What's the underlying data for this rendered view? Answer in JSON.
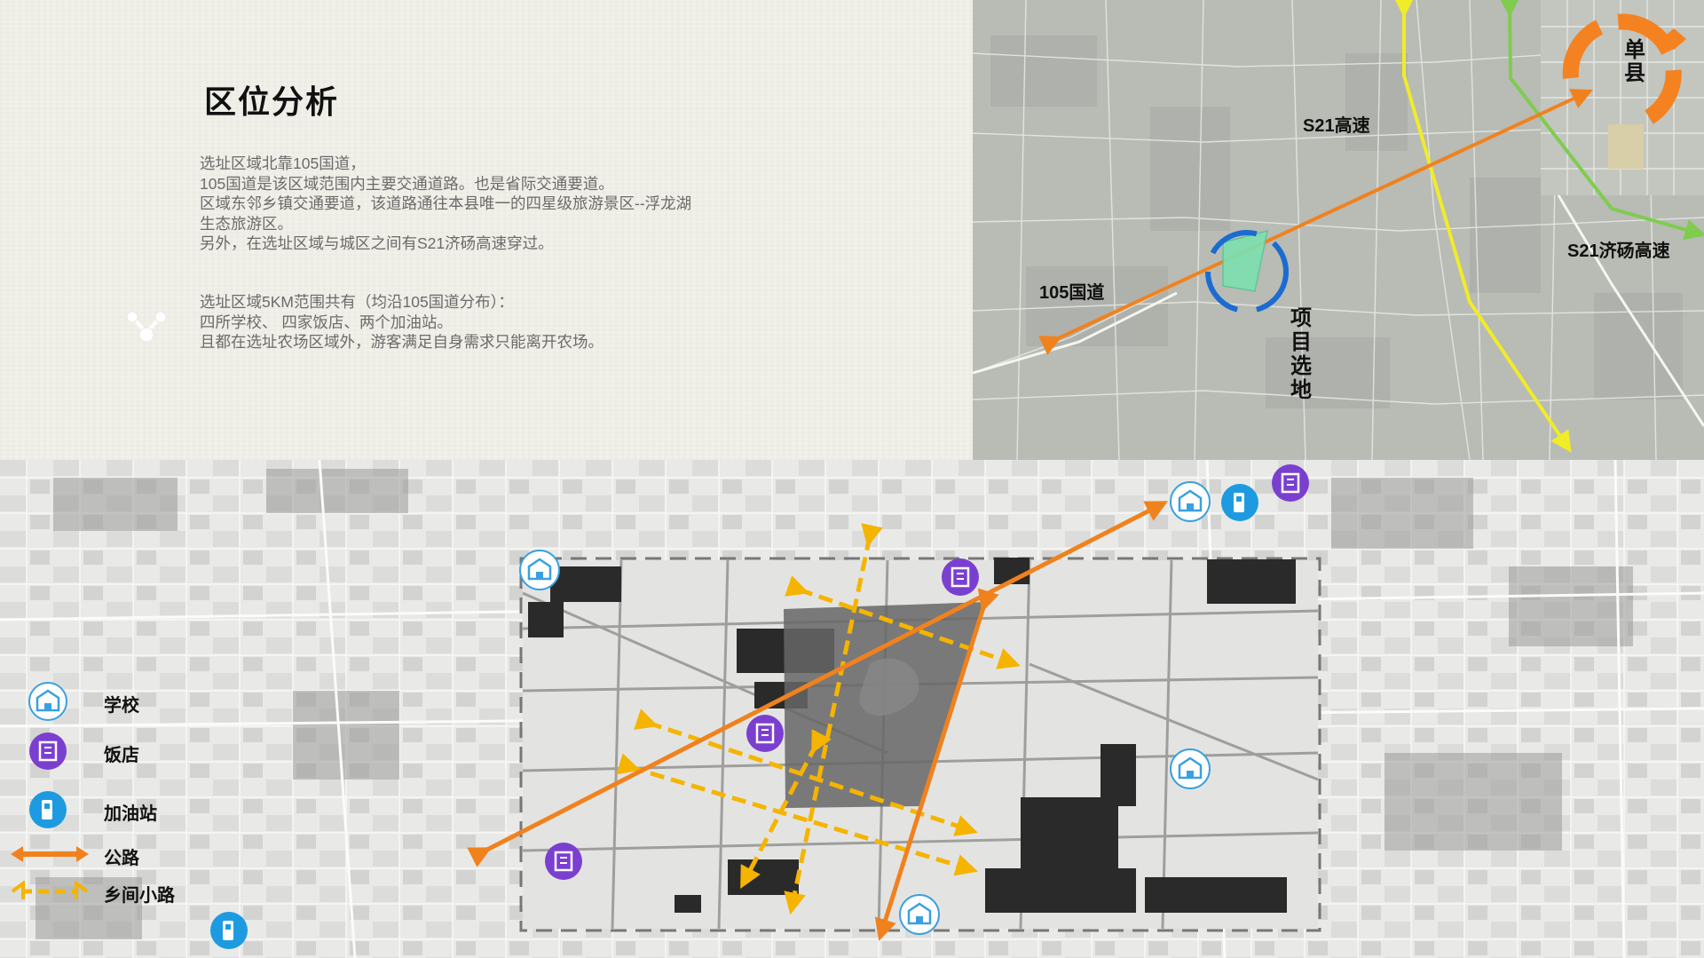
{
  "header": {
    "title": "区位分析"
  },
  "description": {
    "paragraph1": [
      "选址区域北靠105国道，",
      "105国道是该区域范围内主要交通道路。也是省际交通要道。",
      "区域东邻乡镇交通要道，该道路通往本县唯一的四星级旅游景区--浮龙湖",
      "生态旅游区。",
      "另外，在选址区域与城区之间有S21济砀高速穿过。"
    ],
    "paragraph2": [
      "选址区域5KM范围共有（均沿105国道分布）：",
      "四所学校、 四家饭店、两个加油站。",
      "且都在选址农场区域外，游客满足自身需求只能离开农场。"
    ]
  },
  "top_map": {
    "labels": {
      "s21_highway": "S21高速",
      "s21_jidang": "S21济砀高速",
      "road_105": "105国道",
      "county_char1": "单",
      "county_char2": "县",
      "site_chars": [
        "项",
        "目",
        "选",
        "地"
      ]
    },
    "colors": {
      "national_road": "#f0821e",
      "s21": "#f0ec28",
      "s21_jidang": "#7fcc4f",
      "site_fill": "#7de0b0",
      "site_ring": "#1b6cd0",
      "county_ring": "#f58220"
    }
  },
  "legend": {
    "items": [
      {
        "icon": "school-icon",
        "label": "学校"
      },
      {
        "icon": "restaurant-icon",
        "label": "饭店"
      },
      {
        "icon": "gas-station-icon",
        "label": "加油站"
      },
      {
        "icon": "highway-arrow-icon",
        "label": "公路"
      },
      {
        "icon": "country-road-arrow-icon",
        "label": "乡间小路"
      }
    ]
  },
  "colors": {
    "road": "#f0821e",
    "country_road": "#f5b400",
    "school": "#3aa0e0",
    "restaurant": "#7b3fd0",
    "gas_station": "#1e9be0"
  }
}
